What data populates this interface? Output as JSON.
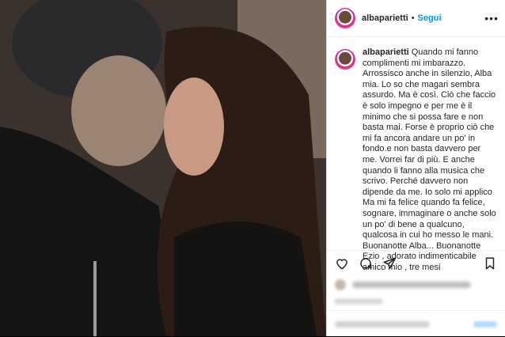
{
  "post": {
    "username": "albaparietti",
    "follow_label": "Segui",
    "separator": "•",
    "more_icon": "ellipsis-icon"
  },
  "caption": {
    "username": "albaparietti",
    "text": "Quando mi fanno complimenti mi imbarazzo. Arrossisco anche in silenzio, Alba mia. Lo so che magari sembra assurdo. Ma è così. Ciò che faccio è solo impegno e per me è il minimo che si possa fare e non basta mai. Forse è proprio ciò che mi fa ancora andare un po' in fondo.e non basta davvero per me. Vorrei far di più. E anche quando li fanno alla musica che scrivo. Perché davvero non dipende da me. Io solo mi applico Ma mi fa felice quando fa felice, sognare, immaginare o anche solo un po' di bene a qualcuno, qualcosa in cui ho messo le mani. Buonanotte Alba... Buonanotte Ezio , adorato indimenticabile amico mio , tre mesi"
  },
  "actions": {
    "icons": [
      "heart-icon",
      "comment-icon",
      "share-icon",
      "bookmark-icon"
    ]
  }
}
